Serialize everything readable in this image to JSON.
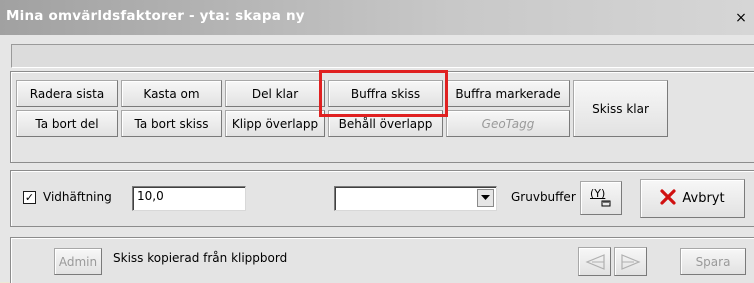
{
  "window": {
    "title": "Mina omvärldsfaktorer - yta: skapa ny",
    "close_label": "×"
  },
  "toolbar": {
    "row1": {
      "radera_sista": "Radera sista",
      "kasta_om": "Kasta om",
      "del_klar": "Del klar",
      "buffra_skiss": "Buffra skiss",
      "buffra_markerade": "Buffra markerade"
    },
    "row2": {
      "ta_bort_del": "Ta bort del",
      "ta_bort_skiss": "Ta bort skiss",
      "klipp_overlapp": "Klipp överlapp",
      "behall_overlapp": "Behåll överlapp",
      "geotagg": "GeoTagg"
    },
    "skiss_klar": "Skiss klar",
    "highlight_color": "#e02020"
  },
  "options": {
    "vidhaftning_checked": true,
    "check_mark": "✓",
    "vidhaftning_label": "Vidhäftning",
    "vidhaftning_value": "10,0",
    "dropdown_value": "",
    "gruvbuffer_label": "Gruvbuffer",
    "gruvbuffer_icon_label": "(Y)",
    "avbryt_label": "Avbryt",
    "avbryt_icon_color": "#d01010"
  },
  "footer": {
    "admin_label": "Admin",
    "status_text": "Skiss kopierad från klippbord",
    "spara_label": "Spara"
  }
}
